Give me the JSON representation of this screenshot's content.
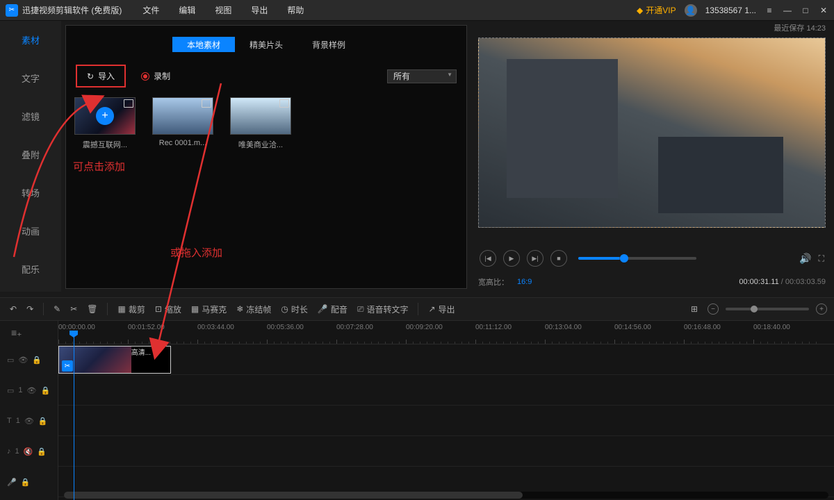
{
  "titlebar": {
    "app_title": "迅捷视频剪辑软件 (免费版)",
    "menu": [
      "文件",
      "编辑",
      "视图",
      "导出",
      "帮助"
    ],
    "vip": "开通VIP",
    "user": "13538567 1...",
    "savetime_label": "最近保存 14:23"
  },
  "nav": [
    "素材",
    "文字",
    "滤镜",
    "叠附",
    "转场",
    "动画",
    "配乐"
  ],
  "panel": {
    "tabs": [
      "本地素材",
      "精美片头",
      "背景样例"
    ],
    "activeTab": 0,
    "import_label": "导入",
    "record_label": "录制",
    "filter_value": "所有",
    "thumbs": [
      {
        "label": "震撼互联网..."
      },
      {
        "label": "Rec 0001.m..."
      },
      {
        "label": "唯美商业洽..."
      }
    ],
    "annotation_click": "可点击添加",
    "annotation_drag": "或拖入添加"
  },
  "preview": {
    "aspect_label": "宽高比：",
    "aspect_value": "16:9",
    "time_current": "00:00:31.11",
    "time_total": "00:03:03.59"
  },
  "toolbar": {
    "buttons": [
      "裁剪",
      "缩放",
      "马赛克",
      "冻结帧",
      "时长",
      "配音",
      "语音转文字",
      "导出"
    ]
  },
  "timeline": {
    "ticks": [
      "00:00:00.00",
      "00:01:52.00",
      "00:03:44.00",
      "00:05:36.00",
      "00:07:28.00",
      "00:09:20.00",
      "00:11:12.00",
      "00:13:04.00",
      "00:14:56.00",
      "00:16:48.00",
      "00:18:40.00"
    ],
    "clip_label": "震撼互联网科技视频高清..."
  }
}
